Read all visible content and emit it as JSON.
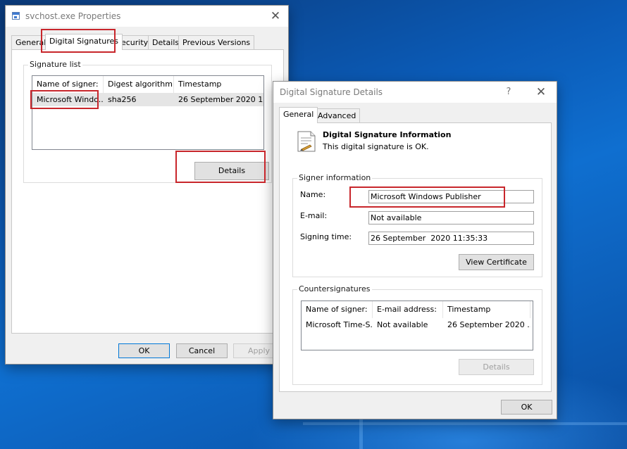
{
  "colors": {
    "highlight_box": "#c8262b",
    "desktop_blue": "#0b5bb7",
    "focus_blue": "#0078d7"
  },
  "properties_window": {
    "title": "svchost.exe Properties",
    "app_icon": "executable-file-icon",
    "close_symbol": "✕",
    "tabs": [
      "General",
      "Digital Signatures",
      "Security",
      "Details",
      "Previous Versions"
    ],
    "active_tab": "Digital Signatures",
    "signature_list": {
      "label": "Signature list",
      "columns": [
        "Name of signer:",
        "Digest algorithm",
        "Timestamp"
      ],
      "rows": [
        [
          "Microsoft Windo...",
          "sha256",
          "26 September 2020 1..."
        ]
      ]
    },
    "details_button": "Details",
    "ok_button": "OK",
    "cancel_button": "Cancel",
    "apply_button": "Apply"
  },
  "signature_details_window": {
    "title": "Digital Signature Details",
    "help_symbol": "?",
    "close_symbol": "✕",
    "tabs": [
      "General",
      "Advanced"
    ],
    "active_tab": "General",
    "info_icon": "certificate-icon",
    "info_heading": "Digital Signature Information",
    "info_status": "This digital signature is OK.",
    "signer_info": {
      "label": "Signer information",
      "name_label": "Name:",
      "name_value": "Microsoft Windows Publisher",
      "email_label": "E-mail:",
      "email_value": "Not available",
      "signing_time_label": "Signing time:",
      "signing_time_value": "26 September  2020 11:35:33",
      "view_certificate_button": "View Certificate"
    },
    "countersignatures": {
      "label": "Countersignatures",
      "columns": [
        "Name of signer:",
        "E-mail address:",
        "Timestamp"
      ],
      "rows": [
        [
          "Microsoft Time-S...",
          "Not available",
          "26 September 2020 ..."
        ]
      ],
      "details_button": "Details"
    },
    "ok_button": "OK"
  }
}
